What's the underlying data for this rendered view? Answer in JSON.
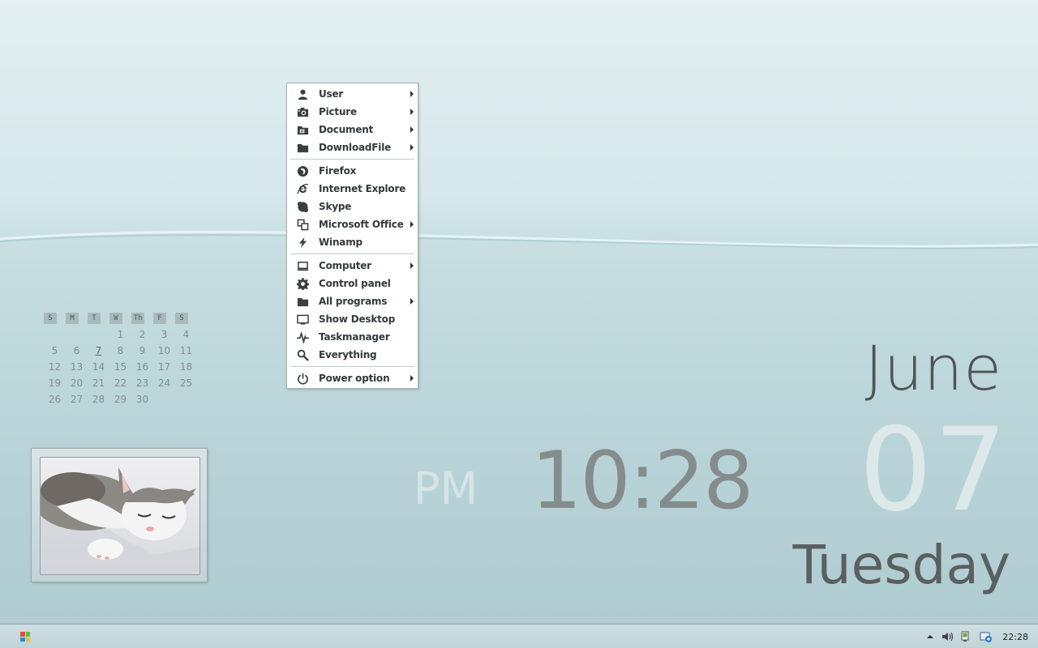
{
  "start_menu": {
    "items": [
      {
        "label": "User",
        "icon": "user-icon",
        "submenu": true
      },
      {
        "label": "Picture",
        "icon": "camera-icon",
        "submenu": true
      },
      {
        "label": "Document",
        "icon": "document-folder-icon",
        "submenu": true
      },
      {
        "label": "DownloadFile",
        "icon": "folder-icon",
        "submenu": true
      },
      {
        "label": "Firefox",
        "icon": "firefox-icon",
        "submenu": false
      },
      {
        "label": "Internet Explore",
        "icon": "internet-explorer-icon",
        "submenu": false
      },
      {
        "label": "Skype",
        "icon": "skype-icon",
        "submenu": false
      },
      {
        "label": "Microsoft Office",
        "icon": "office-icon",
        "submenu": true
      },
      {
        "label": "Winamp",
        "icon": "lightning-icon",
        "submenu": false
      },
      {
        "label": "Computer",
        "icon": "computer-icon",
        "submenu": true
      },
      {
        "label": "Control panel",
        "icon": "gear-icon",
        "submenu": false
      },
      {
        "label": "All programs",
        "icon": "folder-icon",
        "submenu": true
      },
      {
        "label": "Show Desktop",
        "icon": "monitor-icon",
        "submenu": false
      },
      {
        "label": "Taskmanager",
        "icon": "pulse-icon",
        "submenu": false
      },
      {
        "label": "Everything",
        "icon": "search-icon",
        "submenu": false
      },
      {
        "label": "Power option",
        "icon": "power-icon",
        "submenu": true
      }
    ]
  },
  "calendar": {
    "weekdays": [
      "S",
      "M",
      "T",
      "W",
      "Th",
      "F",
      "S"
    ],
    "weeks": [
      [
        "",
        "",
        "",
        "1",
        "2",
        "3",
        "4"
      ],
      [
        "5",
        "6",
        "7",
        "8",
        "9",
        "10",
        "11"
      ],
      [
        "12",
        "13",
        "14",
        "15",
        "16",
        "17",
        "18"
      ],
      [
        "19",
        "20",
        "21",
        "22",
        "23",
        "24",
        "25"
      ],
      [
        "26",
        "27",
        "28",
        "29",
        "30",
        "",
        ""
      ]
    ],
    "today": "7"
  },
  "clock": {
    "month": "June",
    "day": "07",
    "weekday": "Tuesday",
    "time": "10:28",
    "ampm": "PM"
  },
  "taskbar": {
    "start_icon": "windows-logo-icon",
    "tray_icons": [
      "show-hidden-icons-arrow-icon",
      "volume-icon",
      "network-icon",
      "update-icon"
    ],
    "clock": "22:28"
  }
}
